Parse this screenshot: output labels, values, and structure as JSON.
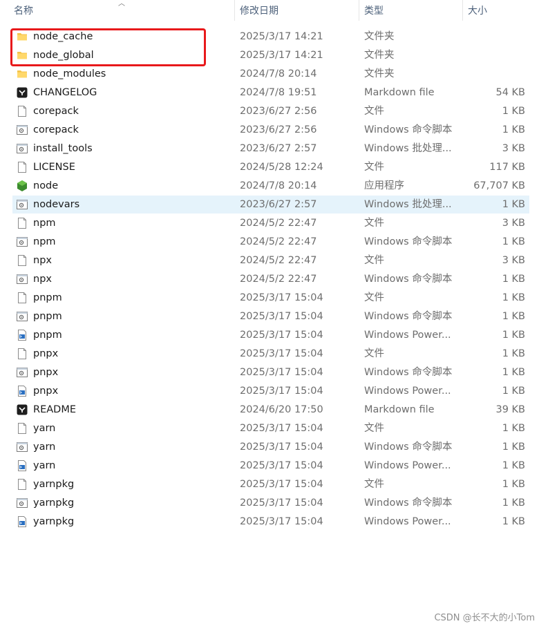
{
  "header": {
    "name_label": "名称",
    "date_label": "修改日期",
    "type_label": "类型",
    "size_label": "大小"
  },
  "files": [
    {
      "name": "node_cache",
      "date": "2025/3/17 14:21",
      "type": "文件夹",
      "size": "",
      "icon": "folder-icon"
    },
    {
      "name": "node_global",
      "date": "2025/3/17 14:21",
      "type": "文件夹",
      "size": "",
      "icon": "folder-icon"
    },
    {
      "name": "node_modules",
      "date": "2024/7/8 20:14",
      "type": "文件夹",
      "size": "",
      "icon": "folder-icon"
    },
    {
      "name": "CHANGELOG",
      "date": "2024/7/8 19:51",
      "type": "Markdown file",
      "size": "54 KB",
      "icon": "markdown-icon"
    },
    {
      "name": "corepack",
      "date": "2023/6/27 2:56",
      "type": "文件",
      "size": "1 KB",
      "icon": "file-icon"
    },
    {
      "name": "corepack",
      "date": "2023/6/27 2:56",
      "type": "Windows 命令脚本",
      "size": "1 KB",
      "icon": "script-icon"
    },
    {
      "name": "install_tools",
      "date": "2023/6/27 2:57",
      "type": "Windows 批处理...",
      "size": "3 KB",
      "icon": "script-icon"
    },
    {
      "name": "LICENSE",
      "date": "2024/5/28 12:24",
      "type": "文件",
      "size": "117 KB",
      "icon": "file-icon"
    },
    {
      "name": "node",
      "date": "2024/7/8 20:14",
      "type": "应用程序",
      "size": "67,707 KB",
      "icon": "nodejs-icon"
    },
    {
      "name": "nodevars",
      "date": "2023/6/27 2:57",
      "type": "Windows 批处理...",
      "size": "1 KB",
      "icon": "script-icon"
    },
    {
      "name": "npm",
      "date": "2024/5/2 22:47",
      "type": "文件",
      "size": "3 KB",
      "icon": "file-icon"
    },
    {
      "name": "npm",
      "date": "2024/5/2 22:47",
      "type": "Windows 命令脚本",
      "size": "1 KB",
      "icon": "script-icon"
    },
    {
      "name": "npx",
      "date": "2024/5/2 22:47",
      "type": "文件",
      "size": "3 KB",
      "icon": "file-icon"
    },
    {
      "name": "npx",
      "date": "2024/5/2 22:47",
      "type": "Windows 命令脚本",
      "size": "1 KB",
      "icon": "script-icon"
    },
    {
      "name": "pnpm",
      "date": "2025/3/17 15:04",
      "type": "文件",
      "size": "1 KB",
      "icon": "file-icon"
    },
    {
      "name": "pnpm",
      "date": "2025/3/17 15:04",
      "type": "Windows 命令脚本",
      "size": "1 KB",
      "icon": "script-icon"
    },
    {
      "name": "pnpm",
      "date": "2025/3/17 15:04",
      "type": "Windows Power...",
      "size": "1 KB",
      "icon": "powershell-icon"
    },
    {
      "name": "pnpx",
      "date": "2025/3/17 15:04",
      "type": "文件",
      "size": "1 KB",
      "icon": "file-icon"
    },
    {
      "name": "pnpx",
      "date": "2025/3/17 15:04",
      "type": "Windows 命令脚本",
      "size": "1 KB",
      "icon": "script-icon"
    },
    {
      "name": "pnpx",
      "date": "2025/3/17 15:04",
      "type": "Windows Power...",
      "size": "1 KB",
      "icon": "powershell-icon"
    },
    {
      "name": "README",
      "date": "2024/6/20 17:50",
      "type": "Markdown file",
      "size": "39 KB",
      "icon": "markdown-icon"
    },
    {
      "name": "yarn",
      "date": "2025/3/17 15:04",
      "type": "文件",
      "size": "1 KB",
      "icon": "file-icon"
    },
    {
      "name": "yarn",
      "date": "2025/3/17 15:04",
      "type": "Windows 命令脚本",
      "size": "1 KB",
      "icon": "script-icon"
    },
    {
      "name": "yarn",
      "date": "2025/3/17 15:04",
      "type": "Windows Power...",
      "size": "1 KB",
      "icon": "powershell-icon"
    },
    {
      "name": "yarnpkg",
      "date": "2025/3/17 15:04",
      "type": "文件",
      "size": "1 KB",
      "icon": "file-icon"
    },
    {
      "name": "yarnpkg",
      "date": "2025/3/17 15:04",
      "type": "Windows 命令脚本",
      "size": "1 KB",
      "icon": "script-icon"
    },
    {
      "name": "yarnpkg",
      "date": "2025/3/17 15:04",
      "type": "Windows Power...",
      "size": "1 KB",
      "icon": "powershell-icon"
    }
  ],
  "selected_row_name": "nodevars",
  "watermark": "CSDN @长不大的小Tom",
  "colors": {
    "highlight_border": "#e8191b",
    "selected_row": "#e5f3fb",
    "folder": "#f4c247",
    "header_text": "#4c607a"
  }
}
